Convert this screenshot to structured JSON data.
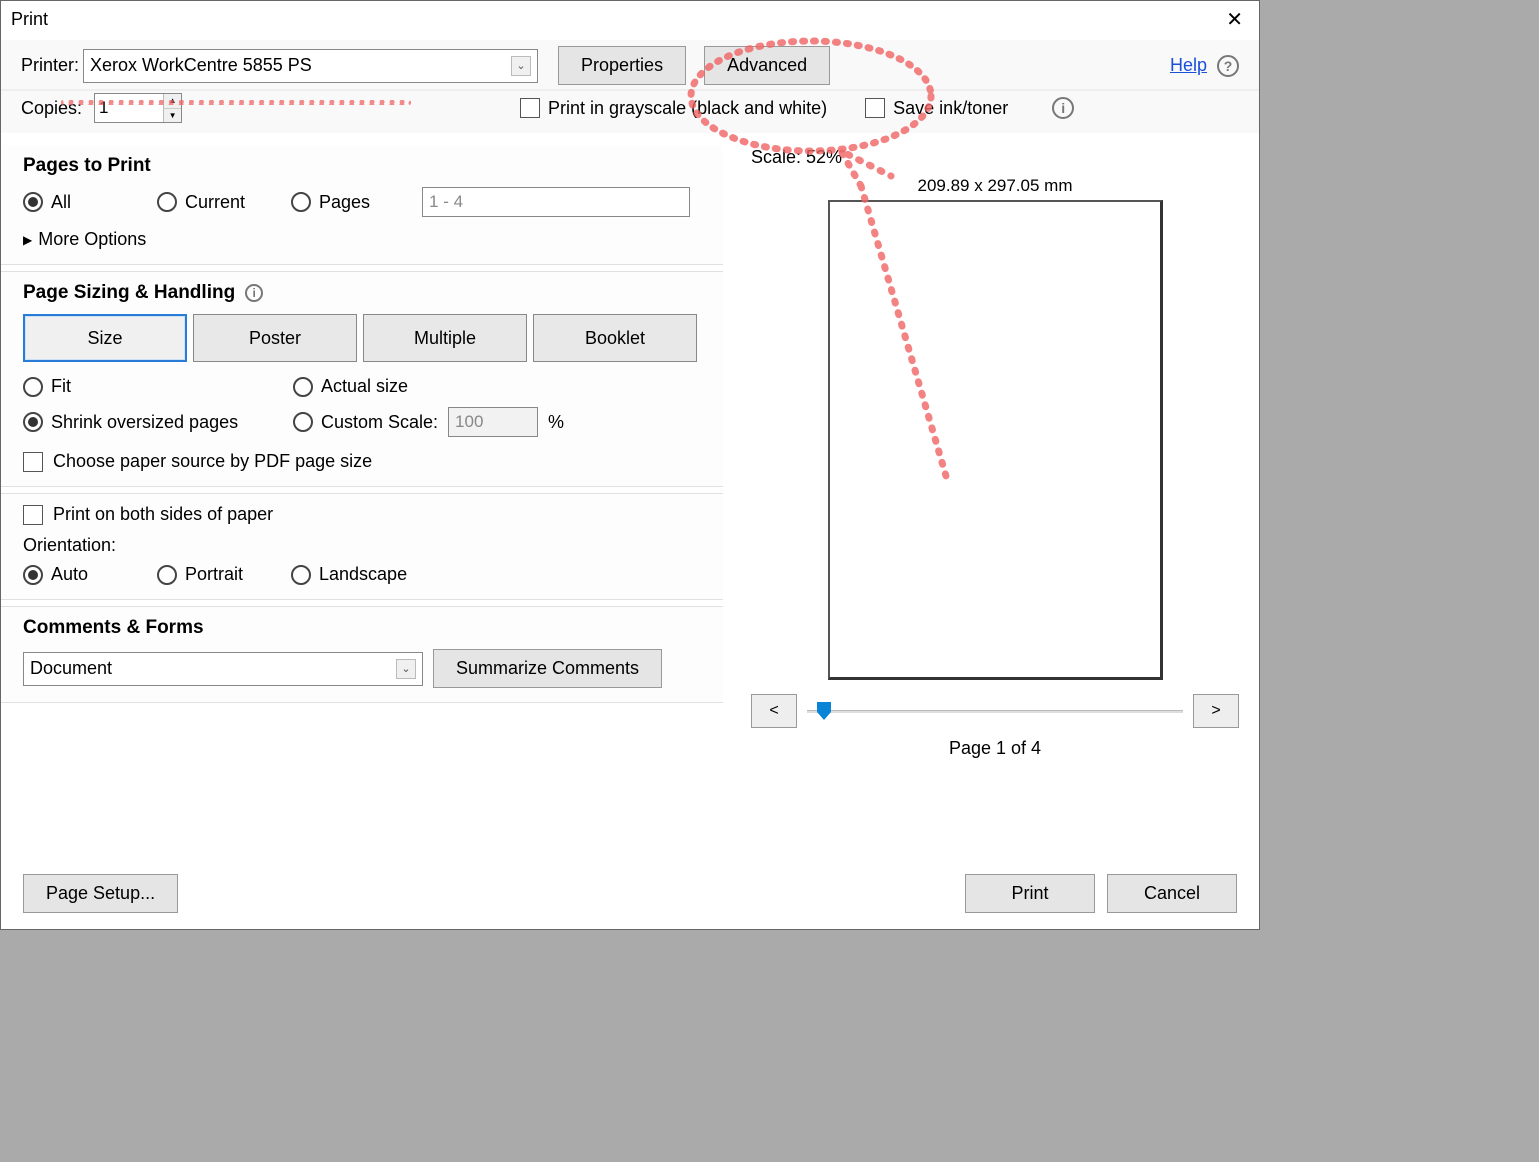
{
  "title": "Print",
  "help": "Help",
  "top": {
    "printer_label": "Printer:",
    "printer_value": "Xerox WorkCentre 5855 PS",
    "properties": "Properties",
    "advanced": "Advanced",
    "copies_label": "Copies:",
    "copies_value": "1",
    "grayscale": "Print in grayscale (black and white)",
    "save_ink": "Save ink/toner"
  },
  "pages": {
    "heading": "Pages to Print",
    "all": "All",
    "current": "Current",
    "pages_label": "Pages",
    "range": "1 - 4",
    "more": "More Options"
  },
  "sizing": {
    "heading": "Page Sizing & Handling",
    "size": "Size",
    "poster": "Poster",
    "multiple": "Multiple",
    "booklet": "Booklet",
    "fit": "Fit",
    "actual": "Actual size",
    "shrink": "Shrink oversized pages",
    "custom_scale": "Custom Scale:",
    "scale_val": "100",
    "percent": "%",
    "choose_source": "Choose paper source by PDF page size"
  },
  "duplex": {
    "both_sides": "Print on both sides of paper",
    "orientation_label": "Orientation:",
    "auto": "Auto",
    "portrait": "Portrait",
    "landscape": "Landscape"
  },
  "comments": {
    "heading": "Comments & Forms",
    "value": "Document",
    "summarize": "Summarize Comments"
  },
  "preview": {
    "scale_label": "Scale:  52%",
    "dims": "209.89 x 297.05 mm",
    "prev": "<",
    "next": ">",
    "page_of": "Page 1 of 4"
  },
  "footer": {
    "page_setup": "Page Setup...",
    "print": "Print",
    "cancel": "Cancel"
  }
}
